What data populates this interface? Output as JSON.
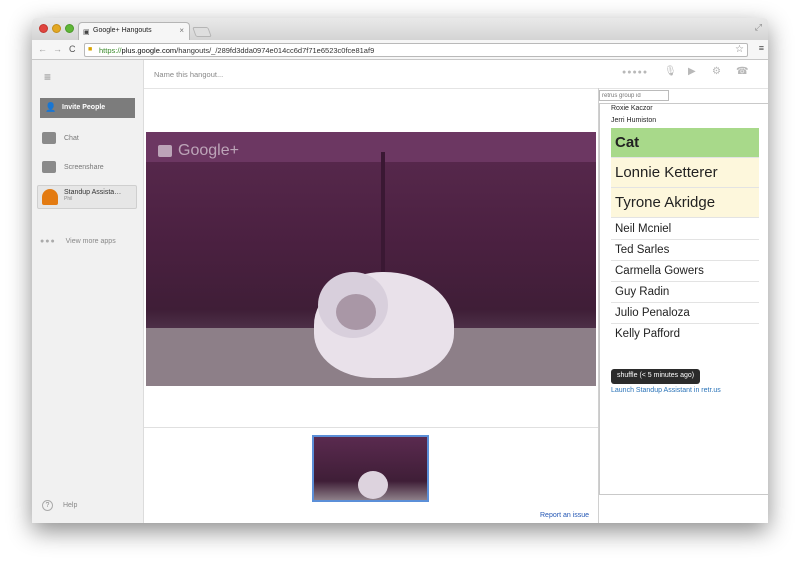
{
  "browser": {
    "tab_title": "Google+ Hangouts",
    "url_scheme": "https://",
    "url_host": "plus.google.com",
    "url_path": "/hangouts/_/289fd3dda0974e014cc6d7f71e6523c0fce81af9"
  },
  "hangout": {
    "name_placeholder": "Name this hangout...",
    "watermark": "Google+",
    "report_link": "Report an issue"
  },
  "leftnav": {
    "invite_label": "Invite People",
    "chat_label": "Chat",
    "screenshare_label": "Screenshare",
    "app_name": "Standup Assista…",
    "app_sub": "Phil",
    "more_apps_label": "View more apps",
    "help_label": "Help"
  },
  "standup": {
    "group_placeholder": "retrus group id",
    "header_names": [
      "Roxie Kaczor",
      "Jerri Humiston"
    ],
    "current": "Cat",
    "up_next": [
      "Lonnie Ketterer",
      "Tyrone Akridge"
    ],
    "remaining": [
      "Neil Mcniel",
      "Ted Sarles",
      "Carmella Gowers",
      "Guy Radin",
      "Julio Penaloza",
      "Kelly Pafford"
    ],
    "shuffle_label": "shuffle (< 5 minutes ago)",
    "launch_link": "Launch Standup Assistant in retr.us",
    "colors": {
      "current_bg": "#a8d98a",
      "upnext_bg": "#fdf7dc"
    }
  }
}
